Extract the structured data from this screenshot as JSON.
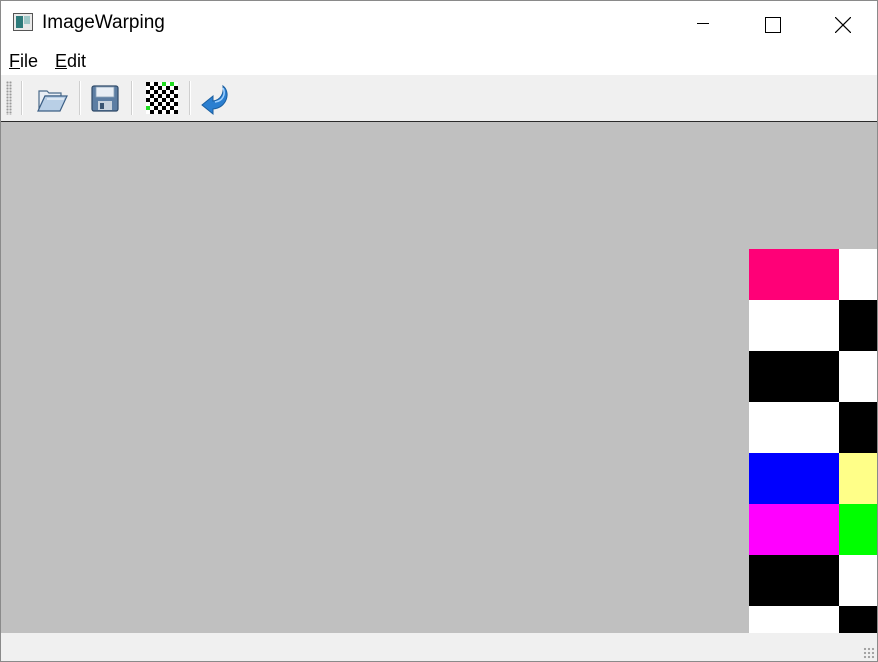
{
  "window": {
    "title": "ImageWarping"
  },
  "menu": {
    "file": "File",
    "edit": "Edit"
  },
  "toolbar": {
    "buttons": [
      {
        "name": "open-file-button",
        "icon": "folder-open-icon"
      },
      {
        "name": "save-file-button",
        "icon": "floppy-disk-icon"
      },
      {
        "name": "warp-button",
        "icon": "checkerboard-icon"
      },
      {
        "name": "undo-button",
        "icon": "undo-arrow-icon"
      }
    ]
  },
  "image": {
    "grid_colors": [
      [
        "#ff0077",
        "#ffffff"
      ],
      [
        "#ffffff",
        "#000000"
      ],
      [
        "#000000",
        "#ffffff"
      ],
      [
        "#ffffff",
        "#000000"
      ],
      [
        "#0000ff",
        "#ffff88"
      ],
      [
        "#ff00ff",
        "#00ff00"
      ],
      [
        "#000000",
        "#ffffff"
      ],
      [
        "#ffffff",
        "#000000"
      ]
    ]
  },
  "colors": {
    "canvas_background": "#c0c0c0",
    "toolbar_background": "#f0f0f0"
  }
}
